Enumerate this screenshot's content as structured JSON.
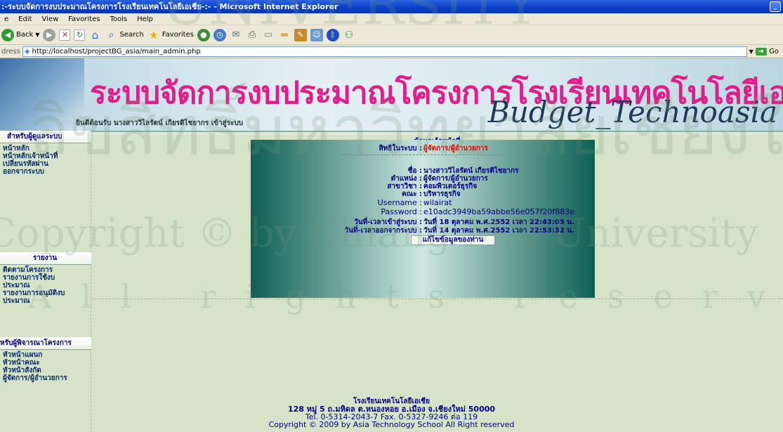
{
  "window": {
    "title": ":-ระบบจัดการงบประมาณโครงการโรงเรียนเทคโนโลยีเอเชีย-:- - Microsoft Internet Explorer"
  },
  "menu": [
    "e",
    "Edit",
    "View",
    "Favorites",
    "Tools",
    "Help"
  ],
  "toolbar": {
    "back": "Back",
    "search": "Search",
    "favorites": "Favorites"
  },
  "address": {
    "label": "dress",
    "url": "http://localhost/projectBG_asia/main_admin.php",
    "go": "Go"
  },
  "banner": {
    "title": "ระบบจัดการงบประมาณโครงการโรงเรียนเทคโนโลยีเอเชีย",
    "subtitle": "Budget_Technoasia",
    "welcome": "ยินดีต้อนรับ นางสาววิไลรัตน์ เกียรติไชยากร เข้าสู่ระบบ"
  },
  "sidebar": {
    "admin_header": "สำหรับผู้ดูแลระบบ",
    "admin_items": [
      "หน้าหลัก",
      "หน้าหลักเจ้าหน้าที่",
      "เปลี่ยนรหัสผ่าน",
      "ออกจากระบบ"
    ],
    "report_header": "รายงาน",
    "report_items": [
      "ติดตามโครงการ",
      "รายงานการใช้งบ",
      "ประมาณ",
      "รายงานการอนุมัติงบ",
      "ประมาณ"
    ],
    "approver_header": "หรับผู้พิจารณาโครงการ",
    "approver_items": [
      "หัวหน้าแผนก",
      "หัวหน้าคณะ",
      "หัวหน้าสังกัด",
      "ผู้จัดการ/ผู้อำนวยการ"
    ]
  },
  "info": {
    "heading": "ข้อมูลเจ้าหน้าที่",
    "role_label": "สิทธิในระบบ :",
    "role_value": "ผู้จัดการ/ผู้อำนวยการ",
    "rows": [
      {
        "k": "ชื่อ :",
        "v": "นางสาววิไลรัตน์ เกียรติไชยากร"
      },
      {
        "k": "ตำแหน่ง :",
        "v": "ผู้จัดการ/ผู้อำนวยการ"
      },
      {
        "k": "สาขาวิชา :",
        "v": "คอมพิวเตอร์ธุรกิจ"
      },
      {
        "k": "คณะ :",
        "v": "บริหารธุรกิจ"
      },
      {
        "k": "Username :",
        "v": "wilairat"
      },
      {
        "k": "Password :",
        "v": "e10adc3949ba59abbe56e057f20f883e"
      },
      {
        "k": "วันที่-เวลาเข้าสู่ระบบ :",
        "v": "วันที่ 18 ตุลาคม พ.ศ.2552 เวลา 22:43:05 น."
      },
      {
        "k": "วันที่-เวลาออกจากระบบ :",
        "v": "วันที่ 14 ตุลาคม พ.ศ.2552 เวลา 22:53:32 น."
      }
    ],
    "edit_button": "แก้ไขข้อมูลของท่าน"
  },
  "footer": {
    "line1": "โรงเรียนเทคโนโลยีเอเชีย",
    "line2": "128 หมู่ 5 ถ.มหิดล ต.หนองหอย อ.เมือง จ.เชียงใหม่ 50000",
    "line3": "Tel. 0-5314-2043-7 Fax. 0-5327-9246 ต่อ 119",
    "line4": "Copyright © 2009 by Asia Technology School All Right reserved"
  },
  "watermark": {
    "line1": "ลิขสิทธิ์มหาวิทยาลัยเชียงใหม่",
    "line2": "Copyright © by Chiang Mai University",
    "line3": "All rights reserved",
    "line4": "UNIVERSITY"
  },
  "colors": {
    "title_bar": "#0a3ec6",
    "banner_title": "#e11d8a",
    "role_value": "#ff0000",
    "page_bg": "#d5e3c9"
  }
}
